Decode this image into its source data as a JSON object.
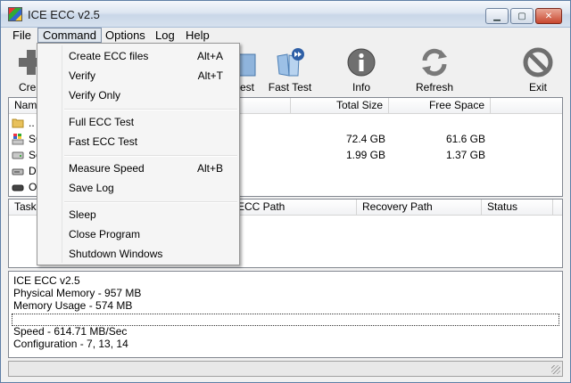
{
  "window": {
    "title": "ICE ECC v2.5"
  },
  "menubar": {
    "items": [
      "File",
      "Command",
      "Options",
      "Log",
      "Help"
    ]
  },
  "toolbar": {
    "buttons": [
      {
        "label": "Crea",
        "icon": "plus-icon"
      },
      {
        "label": "est",
        "icon": "verify-icon"
      },
      {
        "label": "Fast Test",
        "icon": "fast-test-icon"
      },
      {
        "label": "Info",
        "icon": "info-icon"
      },
      {
        "label": "Refresh",
        "icon": "refresh-icon"
      },
      {
        "label": "Exit",
        "icon": "exit-icon"
      }
    ]
  },
  "drives": {
    "headers": [
      "Nam",
      "Total Size",
      "Free Space"
    ],
    "rows": [
      {
        "name": "..",
        "icon": "folder-icon",
        "total": "",
        "free": ""
      },
      {
        "name": "SO",
        "icon": "windows-drive-icon",
        "total": "72.4 GB",
        "free": "61.6 GB"
      },
      {
        "name": "So",
        "icon": "hard-drive-icon",
        "total": "1.99 GB",
        "free": "1.37 GB"
      },
      {
        "name": "DV",
        "icon": "dvd-drive-icon",
        "total": "",
        "free": ""
      },
      {
        "name": "O",
        "icon": "removable-drive-icon",
        "total": "",
        "free": ""
      }
    ]
  },
  "tasks": {
    "headers": [
      "Task",
      "ECC Path",
      "Recovery Path",
      "Status"
    ]
  },
  "log": {
    "lines_top": [
      "ICE ECC v2.5",
      "Physical Memory - 957 MB",
      "Memory Usage - 574 MB"
    ],
    "lines_bottom": [
      "Speed - 614.71 MB/Sec",
      "Configuration - 7, 13, 14"
    ]
  },
  "command_menu": {
    "groups": [
      [
        {
          "label": "Create ECC files",
          "shortcut": "Alt+A"
        },
        {
          "label": "Verify",
          "shortcut": "Alt+T"
        },
        {
          "label": "Verify Only",
          "shortcut": ""
        }
      ],
      [
        {
          "label": "Full ECC Test",
          "shortcut": ""
        },
        {
          "label": "Fast ECC Test",
          "shortcut": ""
        }
      ],
      [
        {
          "label": "Measure Speed",
          "shortcut": "Alt+B"
        },
        {
          "label": "Save Log",
          "shortcut": ""
        }
      ],
      [
        {
          "label": "Sleep",
          "shortcut": ""
        },
        {
          "label": "Close Program",
          "shortcut": ""
        },
        {
          "label": "Shutdown Windows",
          "shortcut": ""
        }
      ]
    ]
  },
  "colors": {
    "accent": "#3a78c4",
    "menu_bg": "#f5f5f5",
    "window_bg": "#f0f0f0"
  }
}
